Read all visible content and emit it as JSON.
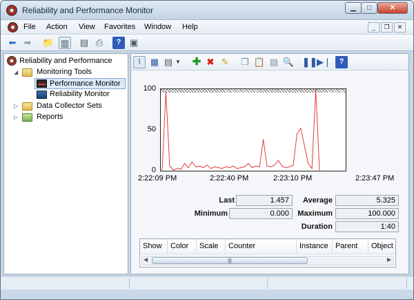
{
  "window": {
    "title": "Reliability and Performance Monitor",
    "controls": {
      "minimize": "▁",
      "maximize": "□",
      "close": "✕"
    }
  },
  "menubar": {
    "items": [
      "File",
      "Action",
      "View",
      "Favorites",
      "Window",
      "Help"
    ],
    "mdi": {
      "minimize": "_",
      "restore": "❐",
      "close": "✕"
    }
  },
  "tree": {
    "root": "Reliability and Performance",
    "monitoring_tools": "Monitoring Tools",
    "performance_monitor": "Performance Monitor",
    "reliability_monitor": "Reliability Monitor",
    "data_collector_sets": "Data Collector Sets",
    "reports": "Reports"
  },
  "graph": {
    "y_ticks": [
      "100",
      "50",
      "0"
    ],
    "x_ticks": [
      "2:22:09 PM",
      "2:22:40 PM",
      "2:23:10 PM",
      "2:23:47 PM"
    ]
  },
  "chart_data": {
    "type": "line",
    "ylim": [
      0,
      100
    ],
    "x_range": [
      "2:22:09 PM",
      "2:23:47 PM"
    ],
    "series": [
      {
        "color": "#e23a3a",
        "values": [
          0,
          98,
          5,
          0,
          2,
          1,
          8,
          3,
          10,
          4,
          5,
          3,
          6,
          2,
          4,
          3,
          2,
          4,
          3,
          5,
          2,
          3,
          4,
          8,
          3,
          5,
          4,
          38,
          5,
          4,
          6,
          12,
          5,
          3,
          4,
          6,
          45,
          52,
          30,
          8,
          2,
          100,
          0
        ]
      }
    ]
  },
  "stats": {
    "last_label": "Last",
    "last": "1.457",
    "average_label": "Average",
    "average": "5.325",
    "minimum_label": "Minimum",
    "minimum": "0.000",
    "maximum_label": "Maximum",
    "maximum": "100.000",
    "duration_label": "Duration",
    "duration": "1:40"
  },
  "table": {
    "columns": [
      "Show",
      "Color",
      "Scale",
      "Counter",
      "Instance",
      "Parent",
      "Object"
    ]
  },
  "scrollbar": {
    "grip": "|||"
  }
}
